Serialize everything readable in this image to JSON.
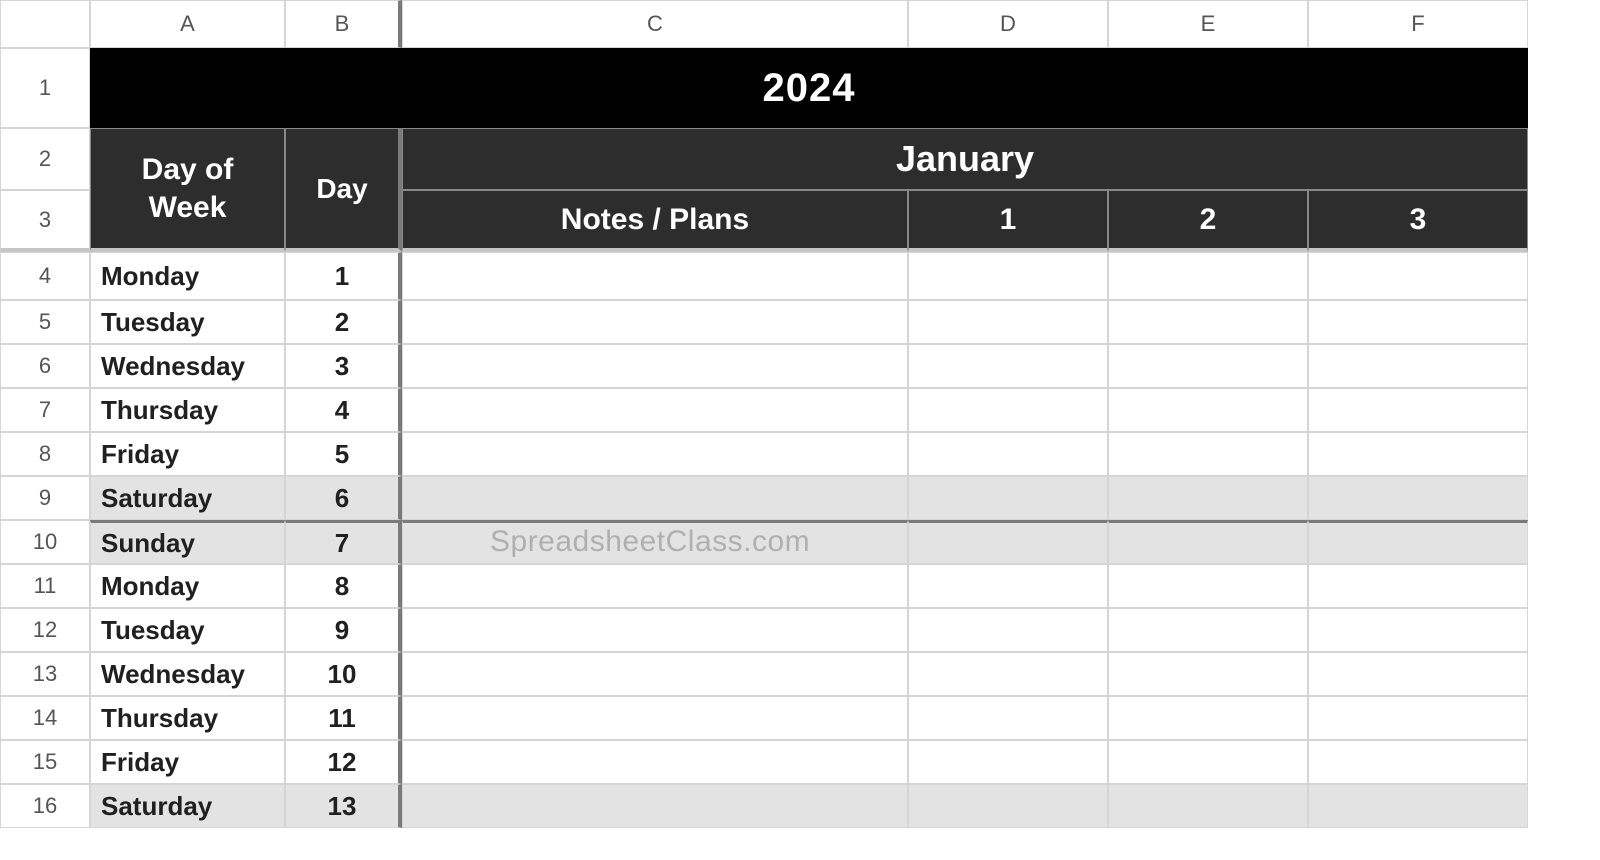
{
  "columns": [
    "A",
    "B",
    "C",
    "D",
    "E",
    "F"
  ],
  "header": {
    "year": "2024",
    "day_of_week_label": "Day of Week",
    "day_label": "Day",
    "month": "January",
    "notes_label": "Notes / Plans",
    "subcols": [
      "1",
      "2",
      "3"
    ]
  },
  "rows": [
    {
      "num": "4",
      "dow": "Monday",
      "day": "1",
      "weekend": false,
      "weeksep": false
    },
    {
      "num": "5",
      "dow": "Tuesday",
      "day": "2",
      "weekend": false,
      "weeksep": false
    },
    {
      "num": "6",
      "dow": "Wednesday",
      "day": "3",
      "weekend": false,
      "weeksep": false
    },
    {
      "num": "7",
      "dow": "Thursday",
      "day": "4",
      "weekend": false,
      "weeksep": false
    },
    {
      "num": "8",
      "dow": "Friday",
      "day": "5",
      "weekend": false,
      "weeksep": false
    },
    {
      "num": "9",
      "dow": "Saturday",
      "day": "6",
      "weekend": true,
      "weeksep": false
    },
    {
      "num": "10",
      "dow": "Sunday",
      "day": "7",
      "weekend": true,
      "weeksep": true
    },
    {
      "num": "11",
      "dow": "Monday",
      "day": "8",
      "weekend": false,
      "weeksep": false
    },
    {
      "num": "12",
      "dow": "Tuesday",
      "day": "9",
      "weekend": false,
      "weeksep": false
    },
    {
      "num": "13",
      "dow": "Wednesday",
      "day": "10",
      "weekend": false,
      "weeksep": false
    },
    {
      "num": "14",
      "dow": "Thursday",
      "day": "11",
      "weekend": false,
      "weeksep": false
    },
    {
      "num": "15",
      "dow": "Friday",
      "day": "12",
      "weekend": false,
      "weeksep": false
    },
    {
      "num": "16",
      "dow": "Saturday",
      "day": "13",
      "weekend": true,
      "weeksep": false
    }
  ],
  "row_header_nums": [
    "1",
    "2",
    "3"
  ],
  "watermark": "SpreadsheetClass.com"
}
